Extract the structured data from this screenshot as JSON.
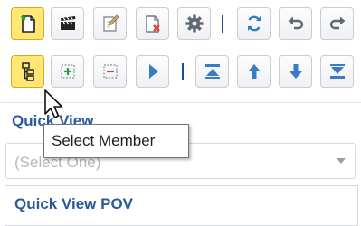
{
  "toolbar": {
    "row1": [
      {
        "icon": "new-document-icon",
        "active": true
      },
      {
        "icon": "clapperboard-icon",
        "active": false
      },
      {
        "icon": "edit-document-icon",
        "active": false
      },
      {
        "icon": "delete-document-icon",
        "active": false
      },
      {
        "icon": "gear-icon",
        "active": false
      },
      {
        "icon": "refresh-icon",
        "active": false
      },
      {
        "icon": "undo-icon",
        "active": false
      },
      {
        "icon": "redo-icon",
        "active": false
      }
    ],
    "row2": [
      {
        "icon": "select-member-icon",
        "active": true
      },
      {
        "icon": "add-member-icon",
        "active": false
      },
      {
        "icon": "remove-member-icon",
        "active": false
      },
      {
        "icon": "play-icon",
        "active": false
      },
      {
        "icon": "move-to-top-icon",
        "active": false
      },
      {
        "icon": "move-up-icon",
        "active": false
      },
      {
        "icon": "move-down-icon",
        "active": false
      },
      {
        "icon": "move-to-bottom-icon",
        "active": false
      }
    ]
  },
  "tooltip": {
    "text": "Select Member"
  },
  "quick_view": {
    "label": "Quick View",
    "select_placeholder": "(Select One)"
  },
  "pov": {
    "title": "Quick View POV"
  },
  "colors": {
    "accent_blue": "#2a5a98",
    "active_button": "#ffe675",
    "icon_gray": "#5f6873",
    "icon_blue": "#3a7cc4",
    "delete_red": "#d9453a",
    "add_green": "#2e9a3a"
  }
}
